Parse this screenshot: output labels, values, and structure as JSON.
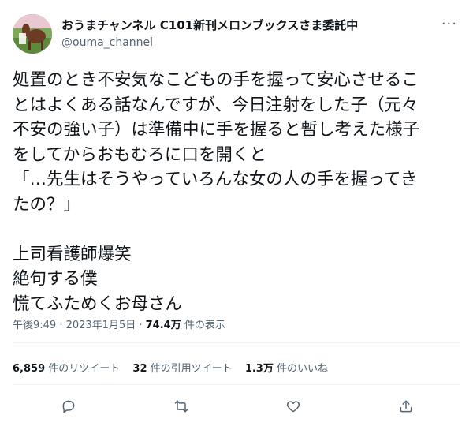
{
  "tweet": {
    "author": {
      "display_name": "おうまチャンネル C101新刊メロンブックスさま委託中",
      "handle": "@ouma_channel"
    },
    "more_icon": "more-dots-icon",
    "text": "処置のとき不安気なこどもの手を握って安心させるこ\nとはよくある話なんですが、今日注射をした子（元々\n不安の強い子）は準備中に手を握ると暫し考えた様子\nをしてからおもむろに口を開くと\n「…先生はそうやっていろんな女の人の手を握ってき\nたの？」\n\n上司看護師爆笑\n絶句する僕\n慌てふためくお母さん",
    "timestamp": "午後9:49 · 2023年1月5日",
    "views_count": "74.4万",
    "views_label": "件の表示",
    "stats": {
      "retweets_count": "6,859",
      "retweets_label": "件のリツイート",
      "quotes_count": "32",
      "quotes_label": "件の引用ツイート",
      "likes_count": "1.3万",
      "likes_label": "件のいいね"
    },
    "actions": [
      "reply-icon",
      "retweet-icon",
      "like-icon",
      "share-icon"
    ]
  },
  "colors": {
    "text": "#0f1419",
    "secondary": "#536471",
    "divider": "#eff3f4"
  }
}
